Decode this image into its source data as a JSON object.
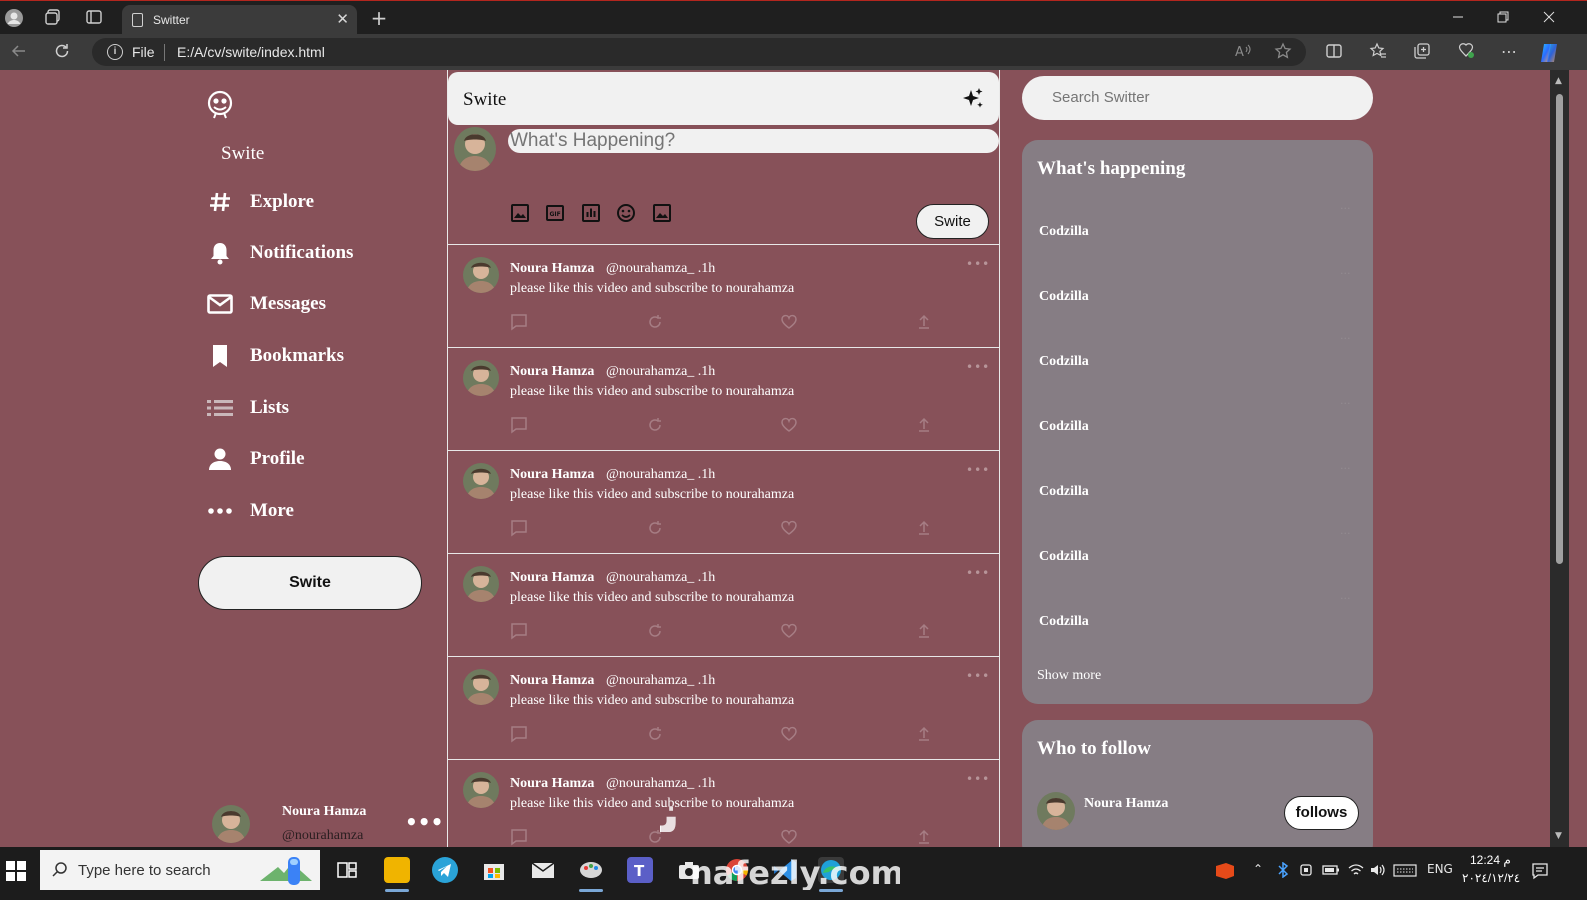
{
  "browser": {
    "tab_title": "Switter",
    "close_glyph": "✕",
    "new_tab_glyph": "+",
    "address_label": "File",
    "url": "E:/A/cv/swite/index.html"
  },
  "sidebar": {
    "brand": "Swite",
    "nav": [
      {
        "label": "Explore",
        "icon": "hashtag-icon"
      },
      {
        "label": "Notifications",
        "icon": "bell-icon"
      },
      {
        "label": "Messages",
        "icon": "mail-icon"
      },
      {
        "label": "Bookmarks",
        "icon": "bookmark-icon"
      },
      {
        "label": "Lists",
        "icon": "list-icon"
      },
      {
        "label": "Profile",
        "icon": "person-icon"
      },
      {
        "label": "More",
        "icon": "more-icon"
      }
    ],
    "swite_button": "Swite",
    "user": {
      "name": "Noura Hamza",
      "handle": "@nourahamza",
      "more": "•••"
    }
  },
  "feed": {
    "title": "Swite",
    "compose_placeholder": "What's Happening?",
    "compose_button": "Swite",
    "posts": [
      {
        "name": "Noura Hamza",
        "handle": "@nourahamza_ .1h",
        "text": "please like this video and subscribe to nourahamza",
        "more": "•••"
      },
      {
        "name": "Noura Hamza",
        "handle": "@nourahamza_ .1h",
        "text": "please like this video and subscribe to nourahamza",
        "more": "•••"
      },
      {
        "name": "Noura Hamza",
        "handle": "@nourahamza_ .1h",
        "text": "please like this video and subscribe to nourahamza",
        "more": "•••"
      },
      {
        "name": "Noura Hamza",
        "handle": "@nourahamza_ .1h",
        "text": "please like this video and subscribe to nourahamza",
        "more": "•••"
      },
      {
        "name": "Noura Hamza",
        "handle": "@nourahamza_ .1h",
        "text": "please like this video and subscribe to nourahamza",
        "more": "•••"
      },
      {
        "name": "Noura Hamza",
        "handle": "@nourahamza_ .1h",
        "text": "please like this video and subscribe to nourahamza",
        "more": "•••"
      }
    ]
  },
  "right": {
    "search_placeholder": "Search Switter",
    "happening_title": "What's happening",
    "trends": [
      "Codzilla",
      "Codzilla",
      "Codzilla",
      "Codzilla",
      "Codzilla",
      "Codzilla",
      "Codzilla"
    ],
    "show_more": "Show more",
    "follow_title": "Who to follow",
    "follow_name": "Noura Hamza",
    "follow_button": "follows"
  },
  "taskbar": {
    "search_placeholder": "Type here to search",
    "lang": "ENG",
    "time": "12:24 م",
    "date": "٢٠٢٤/١٢/٢٤"
  },
  "watermark": {
    "line1": "نفذلي",
    "line2": "nafezly.com"
  },
  "colors": {
    "page_bg": "#875159",
    "card_bg": "#867d84",
    "pill_bg": "#f1f1f1"
  }
}
